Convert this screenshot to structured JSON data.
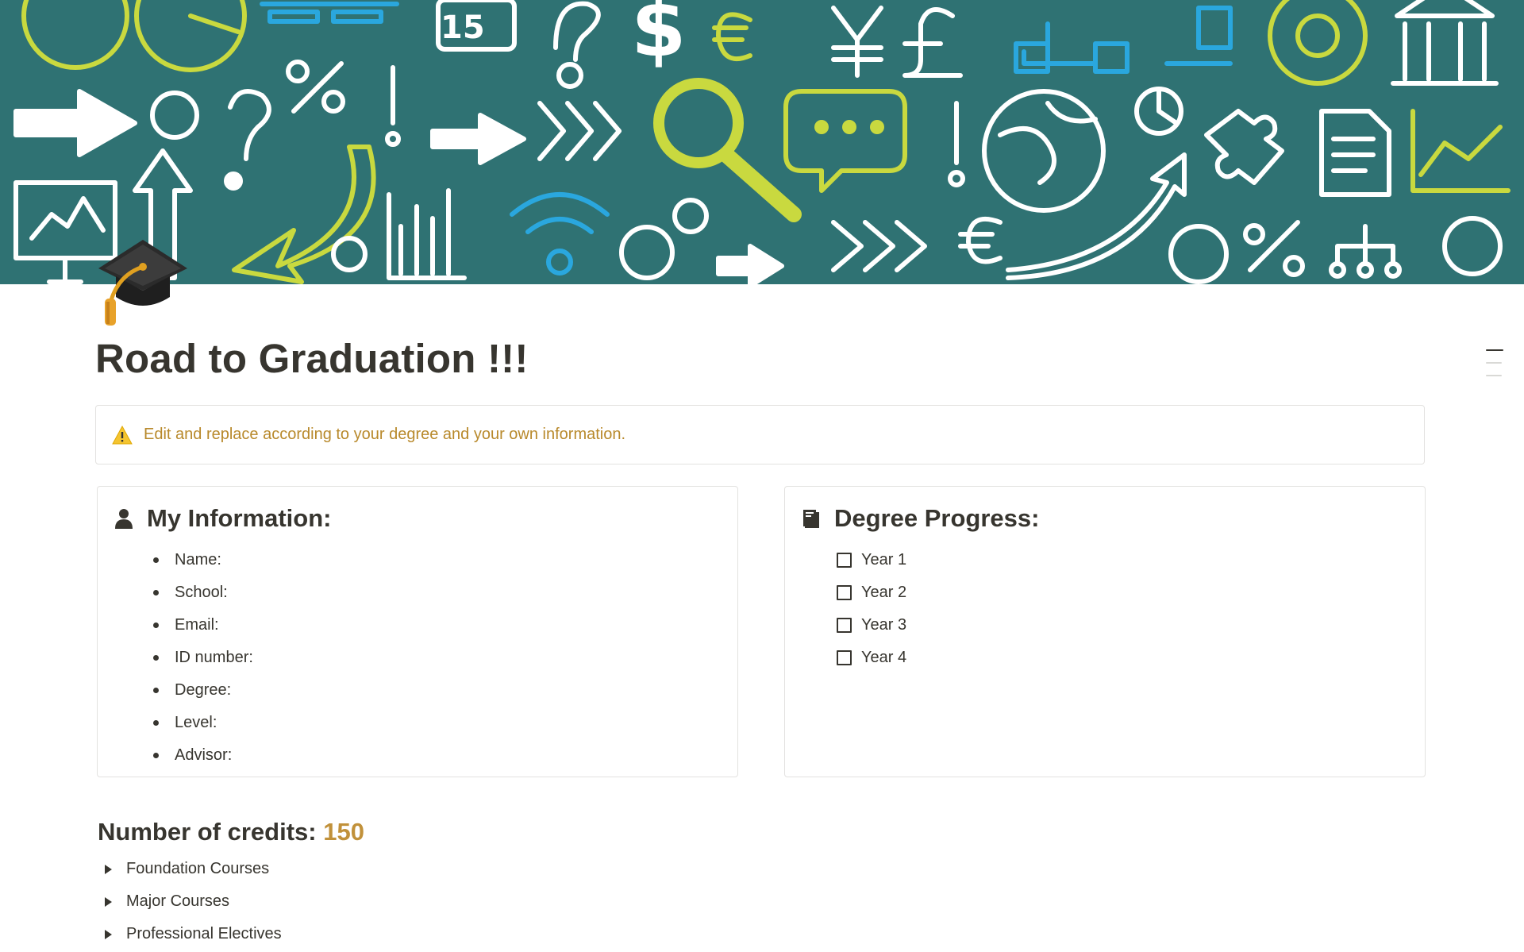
{
  "cover": {
    "icon": "chalkboard-doodle-cover",
    "background": "#2f7273"
  },
  "page": {
    "icon": "graduation-cap-icon",
    "title": "Road to Graduation !!!"
  },
  "callout": {
    "icon": "warning-icon",
    "text": "Edit and replace according to your degree and your own information.",
    "color": "#b8892b"
  },
  "info_card": {
    "icon": "person-icon",
    "heading": "My Information:",
    "items": [
      "Name:",
      "School:",
      "Email:",
      "ID number:",
      "Degree:",
      "Level:",
      "Advisor:"
    ]
  },
  "progress_card": {
    "icon": "book-icon",
    "heading": "Degree Progress:",
    "items": [
      {
        "label": "Year 1",
        "checked": false
      },
      {
        "label": "Year 2",
        "checked": false
      },
      {
        "label": "Year 3",
        "checked": false
      },
      {
        "label": "Year 4",
        "checked": false
      }
    ]
  },
  "credits": {
    "label": "Number of credits: ",
    "value": "150",
    "value_color": "#c1913a"
  },
  "toggles": [
    "Foundation Courses",
    "Major Courses",
    "Professional Electives"
  ]
}
